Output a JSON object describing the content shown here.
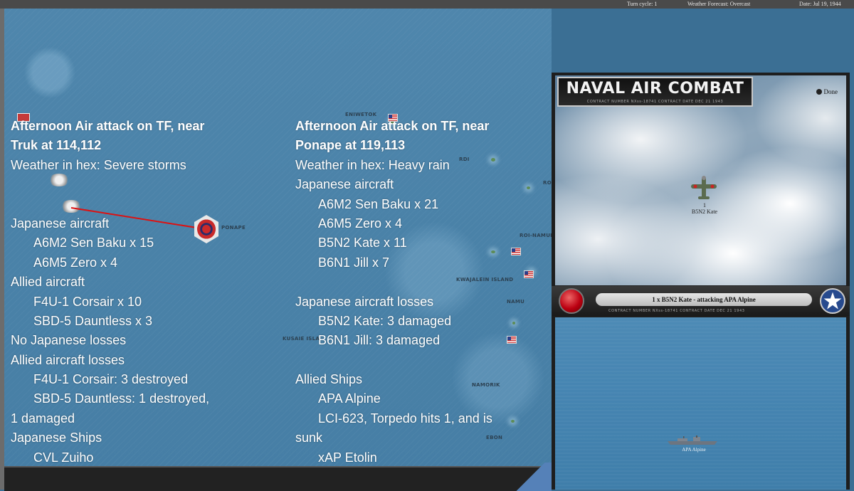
{
  "status_bar": {
    "turn_cycle": "Turn cycle: 1",
    "weather_forecast": "Weather Forecast: Overcast",
    "date": "Date: Jul 19, 1944"
  },
  "map": {
    "places": {
      "eniwetok": "ENIWETOK",
      "ponape": "PONAPE",
      "roi_namur": "ROI-NAMUR",
      "kwajalein": "KWAJALEIN ISLAND",
      "namu": "NAMU",
      "kusaie": "KUSAIE ISLA",
      "namorik": "NAMORIK",
      "ebon": "EBON",
      "rongelap_partial": "RO",
      "ujelang_partial": "RDI"
    }
  },
  "report_left": {
    "lines": [
      "Afternoon Air attack on TF, near",
      "Truk at 114,112",
      "Weather in hex: Severe storms",
      "",
      "",
      "Japanese aircraft",
      "A6M2 Sen Baku x 15",
      "A6M5 Zero x 4",
      "Allied aircraft",
      "F4U-1 Corsair x 10",
      "SBD-5 Dauntless x 3",
      "No Japanese losses",
      "Allied aircraft losses",
      "F4U-1 Corsair: 3 destroyed",
      "SBD-5 Dauntless: 1 destroyed,",
      "1 damaged",
      "Japanese Ships",
      "CVL Zuiho"
    ]
  },
  "report_right": {
    "lines": [
      "Afternoon Air attack on TF, near",
      "Ponape at 119,113",
      "Weather in hex: Heavy rain",
      "Japanese aircraft",
      "A6M2 Sen Baku x 21",
      "A6M5 Zero x 4",
      "B5N2 Kate x 11",
      "B6N1 Jill x 7",
      "",
      "Japanese aircraft losses",
      "B5N2 Kate: 3 damaged",
      "B6N1 Jill: 3 damaged",
      "",
      "Allied Ships",
      "APA Alpine",
      "LCI-623, Torpedo hits 1, and is",
      "sunk",
      "xAP Etolin"
    ]
  },
  "combat_panel": {
    "title": "NAVAL AIR COMBAT",
    "subtitle": "CONTRACT NUMBER NXss-18741          CONTRACT DATE DEC 21 1943",
    "done_label": "Done",
    "aircraft_count": "1",
    "aircraft_name": "B5N2 Kate",
    "message": "1 x B5N2 Kate - attacking APA Alpine",
    "message_sub": "CONTRACT NUMBER NXss-18741          CONTRACT DATE DEC 21 1943",
    "target_ship": "APA Alpine",
    "colors": {
      "red_button": "#b01010",
      "roundel_blue": "#274a8e"
    }
  }
}
